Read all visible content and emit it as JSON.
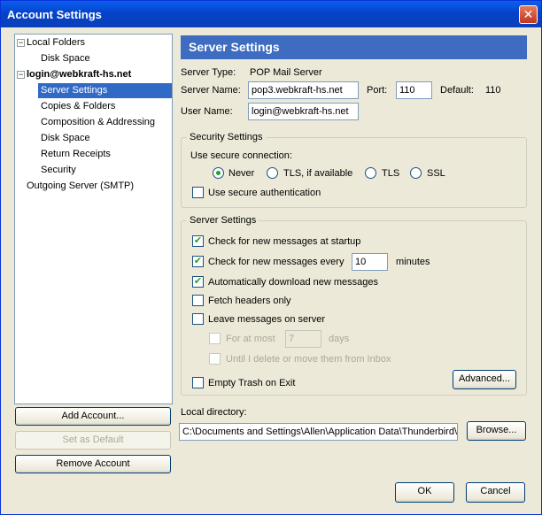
{
  "window": {
    "title": "Account Settings",
    "close_glyph": "✕"
  },
  "tree": {
    "items": [
      {
        "label": "Local Folders",
        "expander": "−"
      },
      {
        "label": "Disk Space"
      },
      {
        "label": "login@webkraft-hs.net",
        "expander": "−"
      },
      {
        "label": "Server Settings"
      },
      {
        "label": "Copies & Folders"
      },
      {
        "label": "Composition & Addressing"
      },
      {
        "label": "Disk Space"
      },
      {
        "label": "Return Receipts"
      },
      {
        "label": "Security"
      },
      {
        "label": "Outgoing Server (SMTP)"
      }
    ]
  },
  "left_buttons": {
    "add_account": "Add Account...",
    "set_default": "Set as Default",
    "remove_account": "Remove Account"
  },
  "panel": {
    "header": "Server Settings",
    "server_type_label": "Server Type:",
    "server_type_value": "POP Mail Server",
    "server_name_label": "Server Name:",
    "server_name_value": "pop3.webkraft-hs.net",
    "port_label": "Port:",
    "port_value": "110",
    "default_label": "Default:",
    "default_value": "110",
    "user_name_label": "User Name:",
    "user_name_value": "login@webkraft-hs.net"
  },
  "security": {
    "legend": "Security Settings",
    "use_secure_label": "Use secure connection:",
    "options": [
      "Never",
      "TLS, if available",
      "TLS",
      "SSL"
    ],
    "selected": "Never",
    "secure_auth_label": "Use secure authentication",
    "secure_auth_checked": false
  },
  "server_settings": {
    "legend": "Server Settings",
    "check_startup": "Check for new messages at startup",
    "check_every": "Check for new messages every",
    "check_every_value": "10",
    "minutes": "minutes",
    "auto_download": "Automatically download new messages",
    "fetch_headers": "Fetch headers only",
    "leave_on_server": "Leave messages on server",
    "for_at_most": "For at most",
    "for_at_most_value": "7",
    "days": "days",
    "until_delete": "Until I delete or move them from Inbox",
    "empty_trash": "Empty Trash on Exit",
    "advanced": "Advanced..."
  },
  "local_directory": {
    "label": "Local directory:",
    "value": "C:\\Documents and Settings\\Allen\\Application Data\\Thunderbird\\",
    "browse": "Browse..."
  },
  "dialog_buttons": {
    "ok": "OK",
    "cancel": "Cancel"
  },
  "checkmark": "✔"
}
